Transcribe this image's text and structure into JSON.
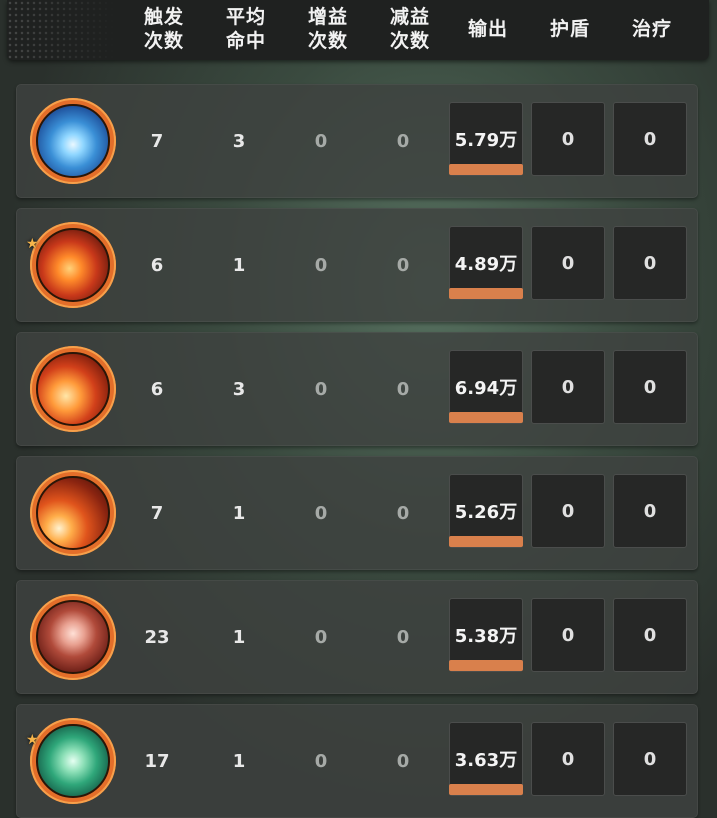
{
  "header": {
    "trigger_count": "触发\n次数",
    "avg_hits": "平均\n命中",
    "buff_count": "增益\n次数",
    "debuff_count": "减益\n次数",
    "output": "输出",
    "shield": "护盾",
    "heal": "治疗"
  },
  "rows": [
    {
      "icon": "ice-burst-icon",
      "starred": false,
      "trigger": "7",
      "avg": "3",
      "buff": "0",
      "debuff": "0",
      "output": "5.79万",
      "output_fraction": 1.0,
      "shield": "0",
      "heal": "0"
    },
    {
      "icon": "fire-swirl-icon",
      "starred": true,
      "trigger": "6",
      "avg": "1",
      "buff": "0",
      "debuff": "0",
      "output": "4.89万",
      "output_fraction": 1.0,
      "shield": "0",
      "heal": "0"
    },
    {
      "icon": "fire-orb-icon",
      "starred": false,
      "trigger": "6",
      "avg": "3",
      "buff": "0",
      "debuff": "0",
      "output": "6.94万",
      "output_fraction": 1.0,
      "shield": "0",
      "heal": "0"
    },
    {
      "icon": "fireball-icon",
      "starred": false,
      "trigger": "7",
      "avg": "1",
      "buff": "0",
      "debuff": "0",
      "output": "5.26万",
      "output_fraction": 1.0,
      "shield": "0",
      "heal": "0"
    },
    {
      "icon": "crimson-orb-icon",
      "starred": false,
      "trigger": "23",
      "avg": "1",
      "buff": "0",
      "debuff": "0",
      "output": "5.38万",
      "output_fraction": 1.0,
      "shield": "0",
      "heal": "0"
    },
    {
      "icon": "jade-orb-icon",
      "starred": true,
      "trigger": "17",
      "avg": "1",
      "buff": "0",
      "debuff": "0",
      "output": "3.63万",
      "output_fraction": 1.0,
      "shield": "0",
      "heal": "0"
    }
  ],
  "colors": {
    "output_bar": "#d9804c",
    "icon_ring": "#e36e2a"
  }
}
